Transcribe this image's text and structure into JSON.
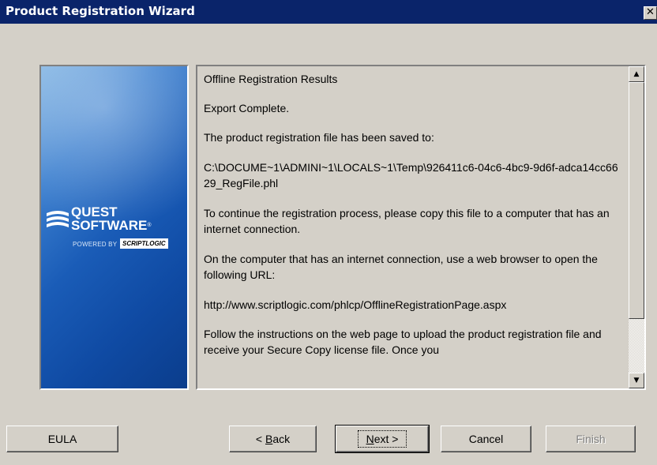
{
  "window": {
    "title": "Product Registration Wizard",
    "close_glyph": "✕"
  },
  "logo": {
    "quest": "QUEST",
    "software": "SOFTWARE",
    "registered": "®",
    "powered_by": "POWERED BY",
    "scriptlogic": "SCRIPTLOGIC"
  },
  "results": {
    "heading": "Offline Registration Results",
    "status": "Export Complete.",
    "saved_label": "The product registration file has been saved to:",
    "file_path": "C:\\DOCUME~1\\ADMINI~1\\LOCALS~1\\Temp\\926411c6-04c6-4bc9-9d6f-adca14cc6629_RegFile.phl",
    "continue_text": "To continue the registration process, please copy this file to a computer that has an internet connection.",
    "browser_text": "On the computer that has an internet connection, use a web browser to open the following URL:",
    "url": "http://www.scriptlogic.com/phlcp/OfflineRegistrationPage.aspx",
    "instructions": "Follow the instructions on the web page to upload the product registration file and receive your Secure Copy license file. Once you"
  },
  "buttons": {
    "eula": "EULA",
    "back_prefix": "< ",
    "back_access": "B",
    "back_rest": "ack",
    "next_access": "N",
    "next_rest": "ext >",
    "cancel": "Cancel",
    "finish": "Finish"
  }
}
